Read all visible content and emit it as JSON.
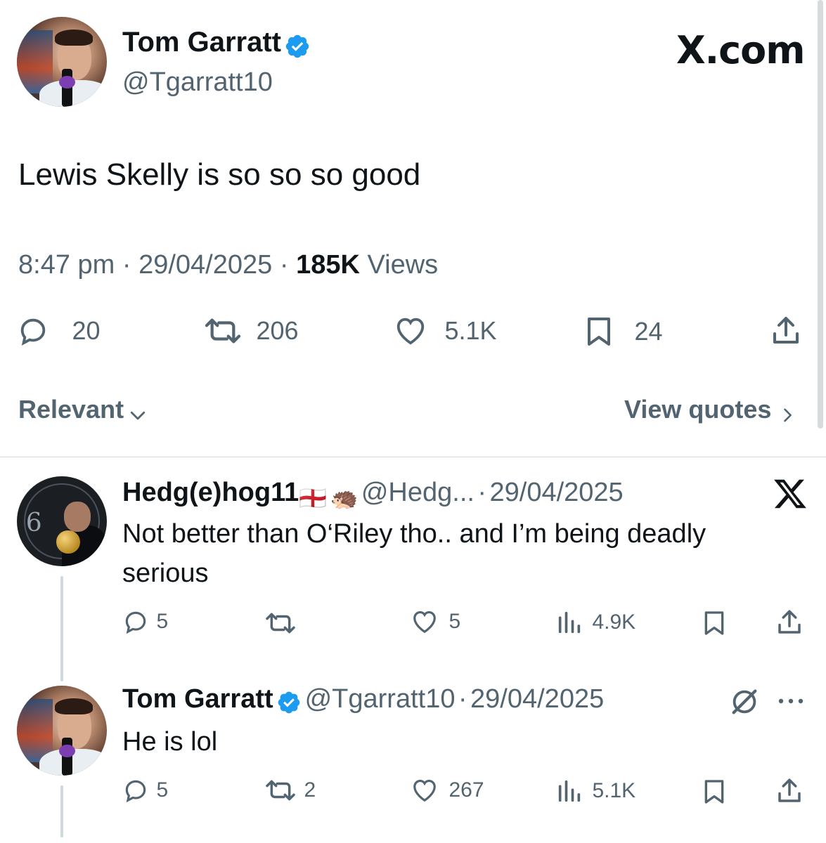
{
  "main_tweet": {
    "author_name": "Tom Garratt",
    "author_handle": "@Tgarratt10",
    "verified": true,
    "text": "Lewis Skelly is so so so good",
    "time": "8:47 pm",
    "date": "29/04/2025",
    "views_count": "185K",
    "views_label": "Views",
    "replies": "20",
    "reposts": "206",
    "likes": "5.1K",
    "bookmarks": "24"
  },
  "branding": {
    "site": "X.com"
  },
  "sort_bar": {
    "sort_label": "Relevant",
    "view_quotes": "View quotes"
  },
  "replies": [
    {
      "author_name": "Hedg(e)hog11",
      "flag": "🏴󠁧󠁢󠁥󠁮󠁧󠁿",
      "emoji": "🦔",
      "author_handle": "@Hedg...",
      "date": "29/04/2025",
      "text": "Not better than O‘Riley tho.. and I’m being deadly serious",
      "replies": "5",
      "reposts": "",
      "likes": "5",
      "views": "4.9K"
    },
    {
      "author_name": "Tom Garratt",
      "verified": true,
      "author_handle": "@Tgarratt10",
      "date": "29/04/2025",
      "text": "He is lol",
      "replies": "5",
      "reposts": "2",
      "likes": "267",
      "views": "5.1K"
    }
  ],
  "separator": "·",
  "icons": {
    "reply": "reply-icon",
    "repost": "repost-icon",
    "like": "heart-icon",
    "bookmark": "bookmark-icon",
    "share": "share-icon",
    "views": "views-icon",
    "verified": "verified-badge-icon",
    "chevron_down": "chevron-down-icon",
    "chevron_right": "chevron-right-icon",
    "more": "more-icon",
    "x_logo": "x-logo-icon",
    "grok": "grok-icon"
  },
  "colors": {
    "verified_blue": "#1d9bf0",
    "text": "#0f1419",
    "muted": "#536471"
  }
}
